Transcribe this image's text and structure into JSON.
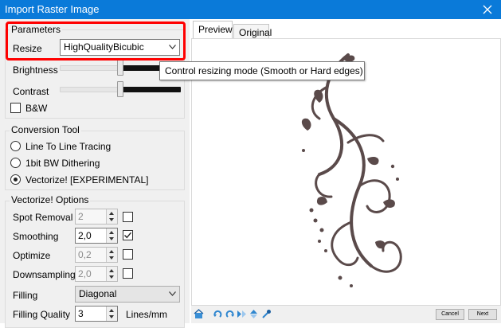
{
  "window": {
    "title": "Import Raster Image"
  },
  "parameters": {
    "group_title": "Parameters",
    "resize_label": "Resize",
    "resize_value": "HighQualityBicubic",
    "brightness_label": "Brightness",
    "contrast_label": "Contrast",
    "bw_label": "B&W",
    "bw_checked": false
  },
  "tooltip": {
    "text": "Control resizing mode (Smooth or Hard edges)"
  },
  "conversion": {
    "group_title": "Conversion Tool",
    "options": [
      {
        "label": "Line To Line Tracing",
        "selected": false
      },
      {
        "label": "1bit BW Dithering",
        "selected": false
      },
      {
        "label": "Vectorize! [EXPERIMENTAL]",
        "selected": true
      }
    ]
  },
  "vectorize": {
    "group_title": "Vectorize! Options",
    "spot_removal": {
      "label": "Spot Removal",
      "value": "2",
      "enabled": false
    },
    "smoothing": {
      "label": "Smoothing",
      "value": "2,0",
      "enabled": true
    },
    "optimize": {
      "label": "Optimize",
      "value": "0,2",
      "enabled": false
    },
    "downsampling": {
      "label": "Downsampling",
      "value": "2,0",
      "enabled": false
    },
    "filling_label": "Filling",
    "filling_value": "Diagonal",
    "filling_quality_label": "Filling Quality",
    "filling_quality_value": "3",
    "filling_quality_unit": "Lines/mm"
  },
  "tabs": [
    {
      "label": "Preview",
      "active": true
    },
    {
      "label": "Original",
      "active": false
    }
  ],
  "buttons": {
    "cancel": "Cancel",
    "next": "Next"
  },
  "colors": {
    "titlebar": "#0a7ad9",
    "highlight": "#ff0000",
    "ornament": "#5a4a4a"
  }
}
